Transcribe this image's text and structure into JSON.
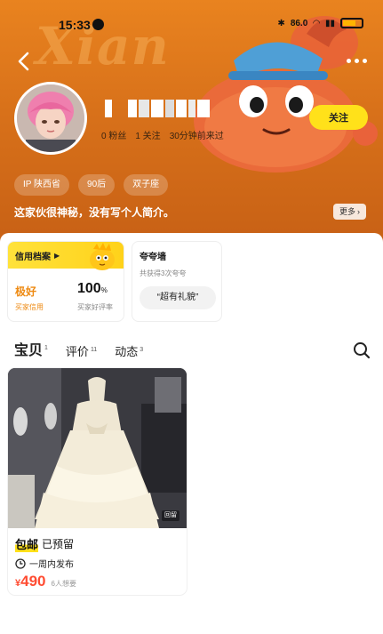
{
  "status_bar": {
    "time": "15:33",
    "network_speed": "86.0\nKB/S",
    "network_label": "86.0"
  },
  "profile": {
    "followers_label": "0 粉丝",
    "following_label": "1 关注",
    "last_active": "30分钟前来过",
    "follow_button": "关注",
    "tags": [
      "IP 陕西省",
      "90后",
      "双子座"
    ],
    "bio": "这家伙很神秘，没有写个人简介。",
    "more_button": "更多"
  },
  "credit_card": {
    "title": "信用档案",
    "level": "极好",
    "level_caption": "买家信用",
    "rate_value": "100",
    "rate_unit": "%",
    "rate_caption": "买家好评率"
  },
  "praise_card": {
    "title": "夸夸墙",
    "subtitle": "共获得3次夸夸",
    "pill": "“超有礼貌”"
  },
  "tabs": [
    {
      "label": "宝贝",
      "count": "1",
      "active": true
    },
    {
      "label": "评价",
      "count": "11",
      "active": false
    },
    {
      "label": "动态",
      "count": "3",
      "active": false
    }
  ],
  "listing": {
    "photo_badge": "回留",
    "shipping": "包邮",
    "status": "已预留",
    "posted": "一周内发布",
    "currency": "¥",
    "price": "490",
    "wants": "6人想要"
  },
  "colors": {
    "hero": "#d8711a",
    "accent_yellow": "#ffe11a",
    "price_red": "#ff4d33",
    "credit_orange": "#ee8a12"
  }
}
